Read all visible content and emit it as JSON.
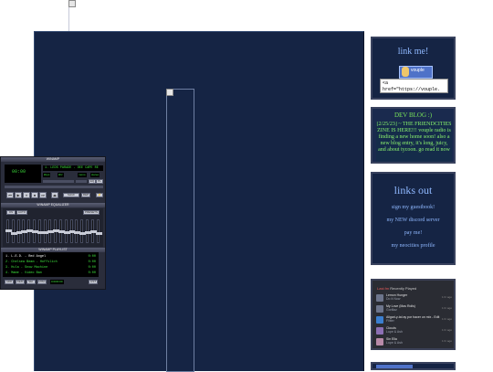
{
  "main": {
    "linkme": {
      "title": "link me!",
      "badge_text": "vouple",
      "code_snippet": "<a href=\"https://vouple."
    },
    "devblog": {
      "header": "DEV BLOG :)",
      "body": "[2/25/23] ~ THE FRIENDCITIES ZINE IS HERE!!! vouple radio is finding a new home soon! also a new blog entry, it's long, juicy, and about tycoon. go read it now"
    },
    "links_out": {
      "title": "links out",
      "items": [
        "sign my guestbook!",
        "my NEW discord server",
        "pay me!",
        "my neocities profile"
      ]
    },
    "recent_playlist": {
      "brand": "Last.fm",
      "heading": "Recently Played",
      "tracks": [
        {
          "title": "Lemon Hunger",
          "artist": "Do It Now",
          "ago": "1 hr ago"
        },
        {
          "title": "My Love (Mas Rolls)",
          "artist": "Gorillaz",
          "ago": "1 hr ago"
        },
        {
          "title": "Aligari-y-tal ay por hacer un mix - Edit",
          "artist": "Flitter",
          "ago": "1 hr ago"
        },
        {
          "title": "Clouds",
          "artist": "Lupe & Ash",
          "ago": "1 hr ago"
        },
        {
          "title": "Sin Ella",
          "artist": "Lupe & Ash",
          "ago": "1 hr ago"
        }
      ]
    }
  },
  "winamp": {
    "title": "WINAMP",
    "time": "00:00",
    "song_title": "1. LEDS PARADE - DEE CAPE RE",
    "kbps": "kbps",
    "khz": "khz",
    "mono": "mono",
    "stereo": "stereo",
    "eq_label": "WINAMP EQUALIZER",
    "eq_on": "ON",
    "eq_auto": "AUTO",
    "eq_presets": "PRESETS",
    "pl_label": "WINAMP PLAYLIST",
    "playlist": [
      {
        "text": "1. L.E.D. - Red Angel",
        "dur": "0:00"
      },
      {
        "text": "2. Chelsea Beam - Hoffslich",
        "dur": "0:00"
      },
      {
        "text": "3. Hula - Snow Machine",
        "dur": "0:00"
      },
      {
        "text": "4. Mame - Video Ban",
        "dur": "0:00"
      }
    ],
    "pl_time": "0:00/0:00",
    "eq_levels": [
      0.55,
      0.4,
      0.45,
      0.5,
      0.55,
      0.5,
      0.45,
      0.45,
      0.5,
      0.55,
      0.5,
      0.45,
      0.5,
      0.45,
      0.4,
      0.45,
      0.5,
      0.4
    ]
  }
}
